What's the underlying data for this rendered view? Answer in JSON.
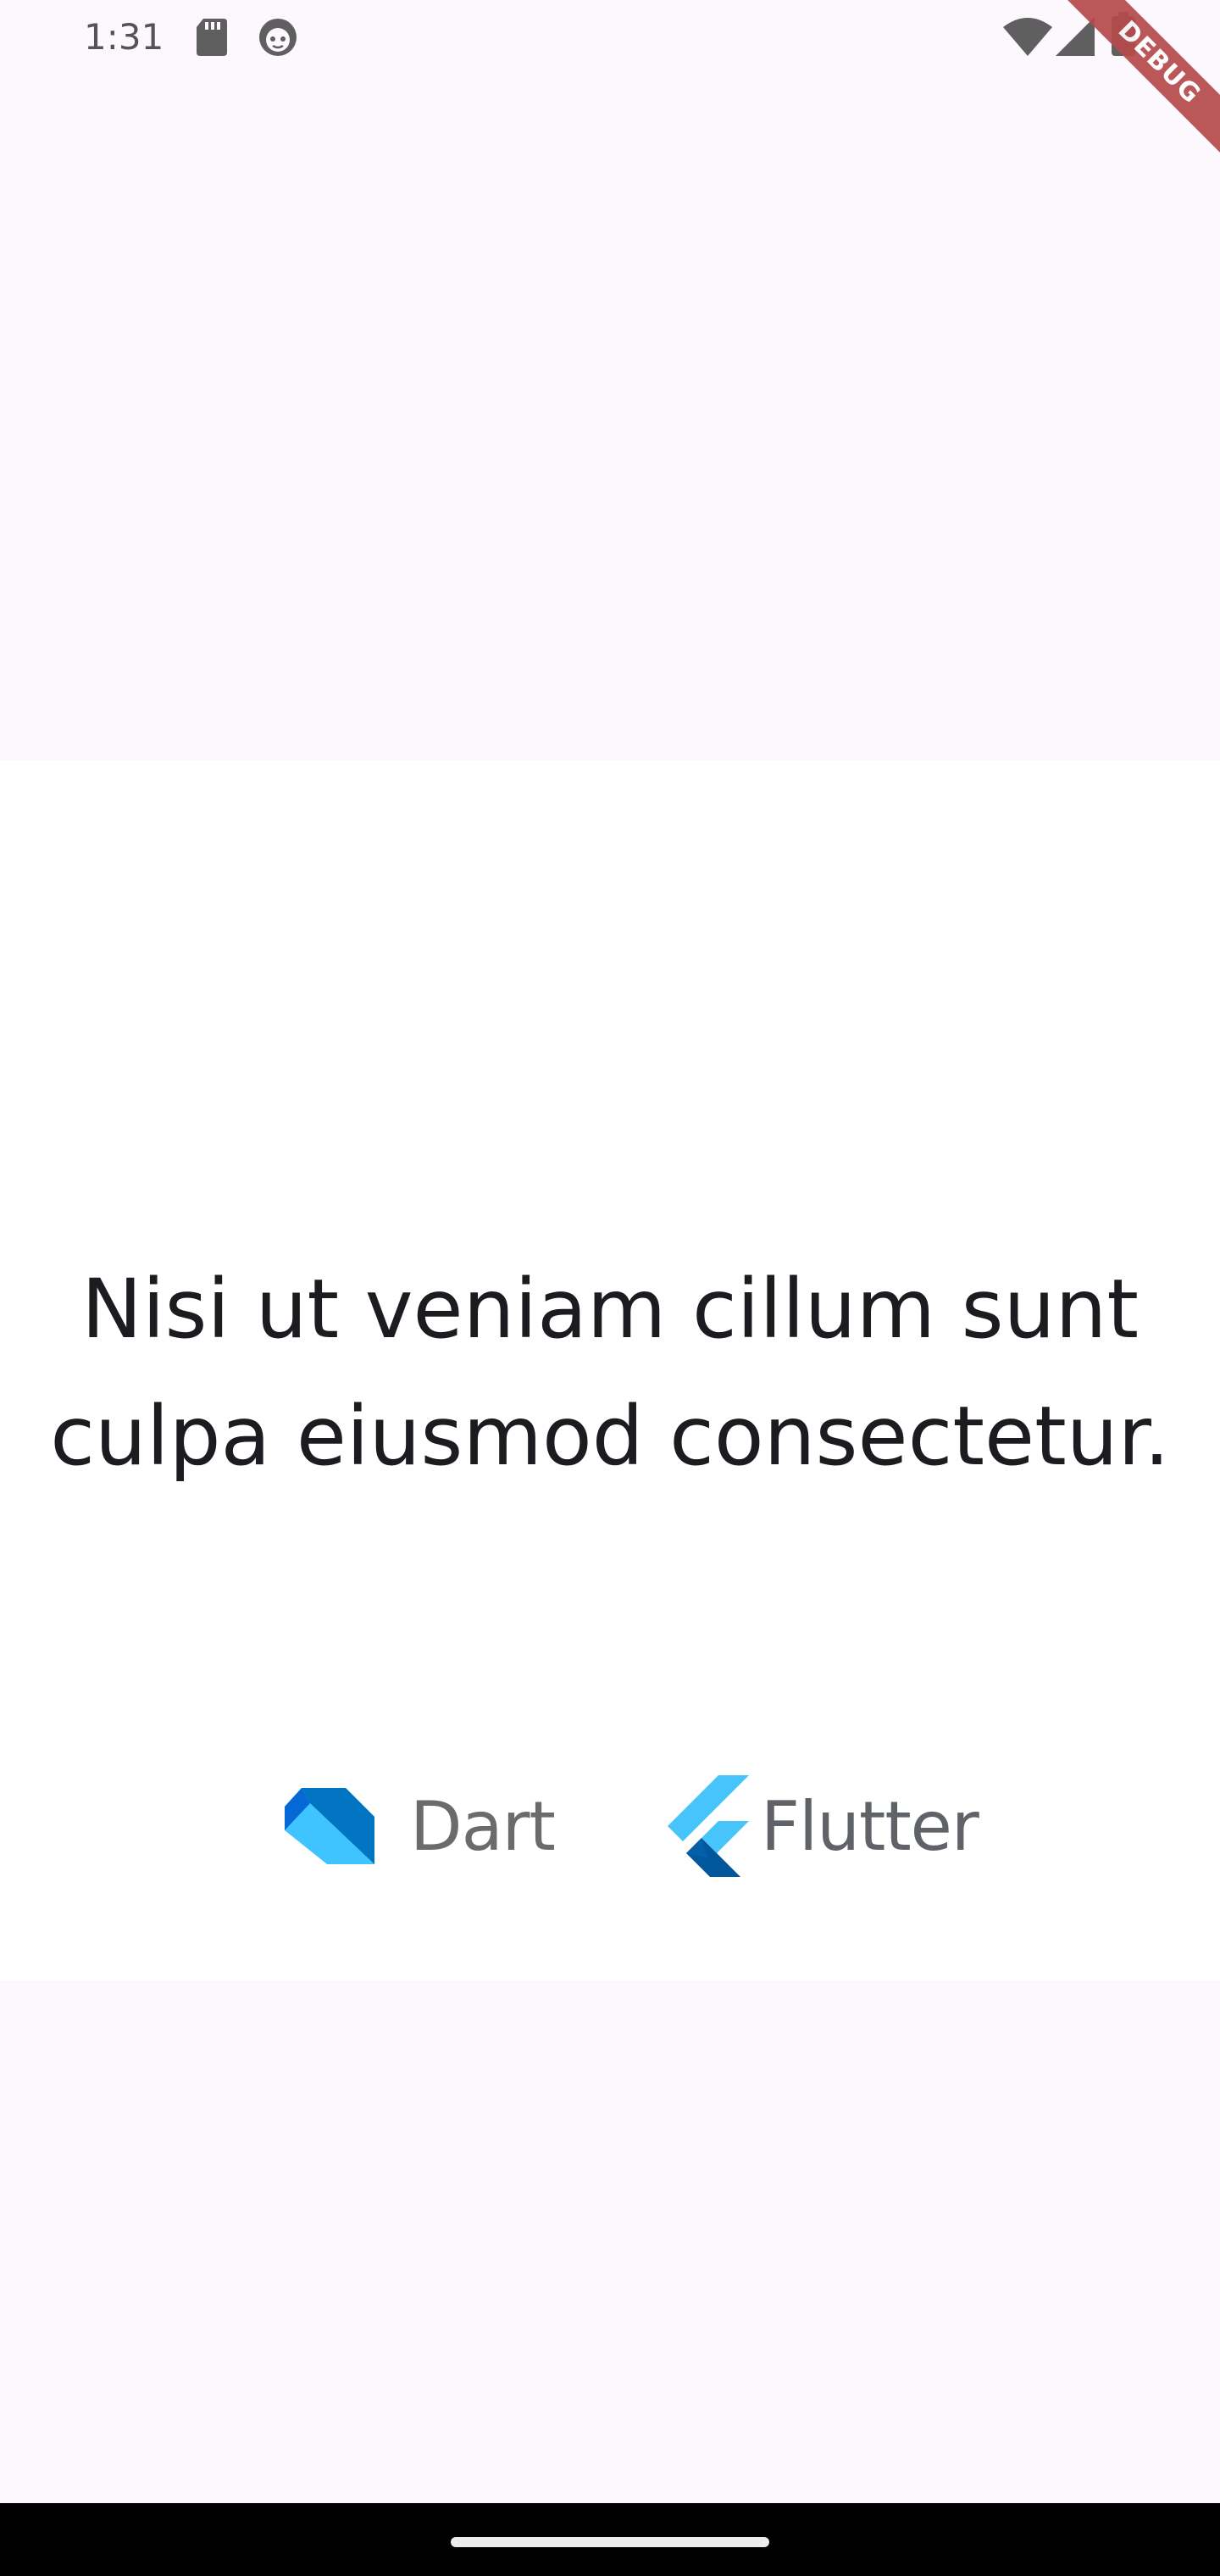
{
  "status_bar": {
    "time": "1:31",
    "icons": [
      "sd-card-icon",
      "face-icon",
      "wifi-icon",
      "signal-icon",
      "battery-icon"
    ]
  },
  "debug_banner": {
    "label": "DEBUG",
    "color": "#b54a4a"
  },
  "content": {
    "headline": "Nisi ut veniam cillum sunt culpa eiusmod consectetur.",
    "logos": [
      {
        "name": "Dart",
        "icon": "dart-logo-icon"
      },
      {
        "name": "Flutter",
        "icon": "flutter-logo-icon"
      }
    ]
  },
  "colors": {
    "background": "#fdf7fe",
    "card": "#ffffff",
    "text": "#1c1b1f",
    "dart_dark": "#0175c2",
    "dart_light": "#40c4ff",
    "flutter_light": "#47c5fb",
    "flutter_dark": "#02569b"
  }
}
